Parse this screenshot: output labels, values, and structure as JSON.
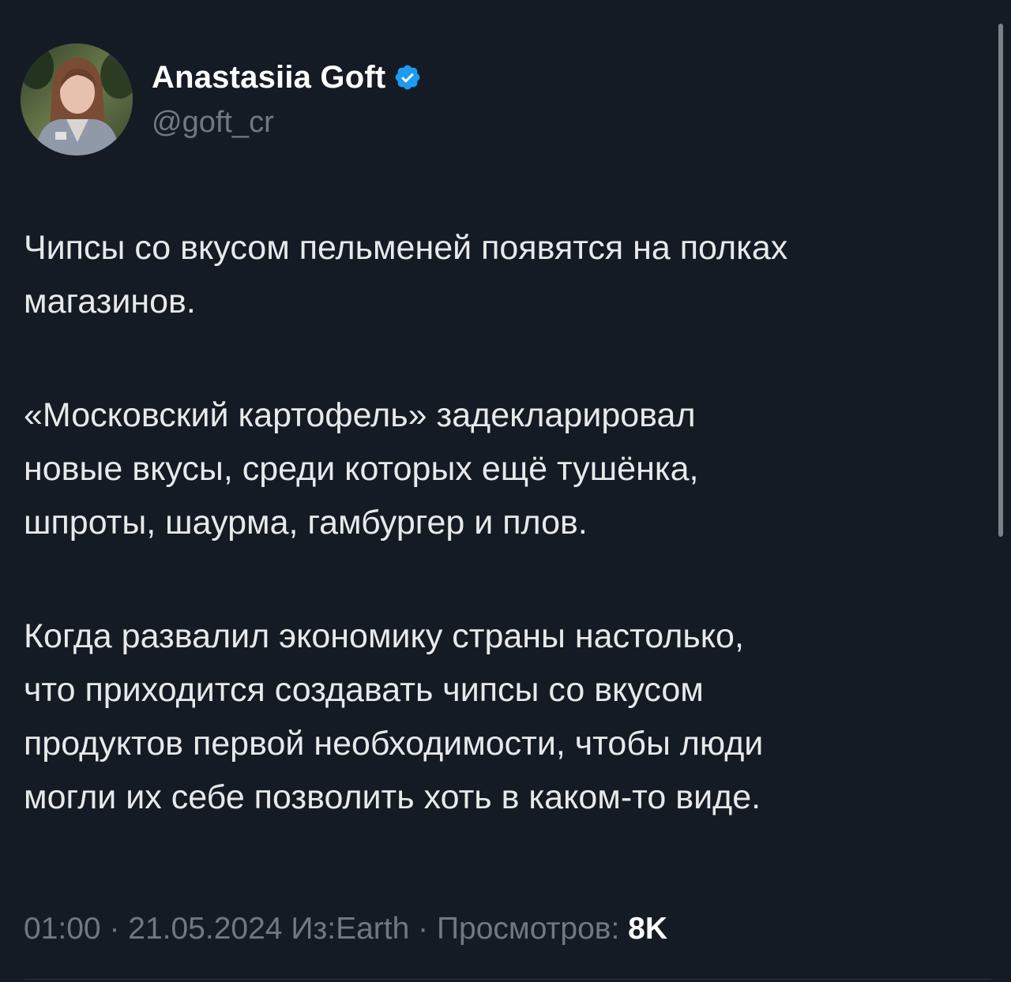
{
  "author": {
    "display_name": "Anastasiia Goft",
    "handle": "@goft_cr",
    "verified_icon": "verified-badge-icon",
    "verified_color": "#1d9bf0"
  },
  "tweet": {
    "paragraphs": [
      "Чипсы со вкусом пельменей появятся на полках\nмагазинов.",
      "«Московский картофель» задекларировал\nновые вкусы, среди которых ещё тушёнка,\nшпроты, шаурма, гамбургер и плов.",
      "Когда развалил экономику страны настолько,\nчто приходится создавать чипсы со вкусом\nпродуктов первой необходимости, чтобы люди\nмогли их себе позволить хоть в каком-то виде."
    ]
  },
  "meta": {
    "time": "01:00",
    "separator": " · ",
    "date": "21.05.2024",
    "source": "Из:Earth",
    "views_label": "Просмотров:",
    "views_count": "8K"
  },
  "colors": {
    "background": "#151b24",
    "text": "#e7e9ea",
    "muted": "#6f7983"
  }
}
